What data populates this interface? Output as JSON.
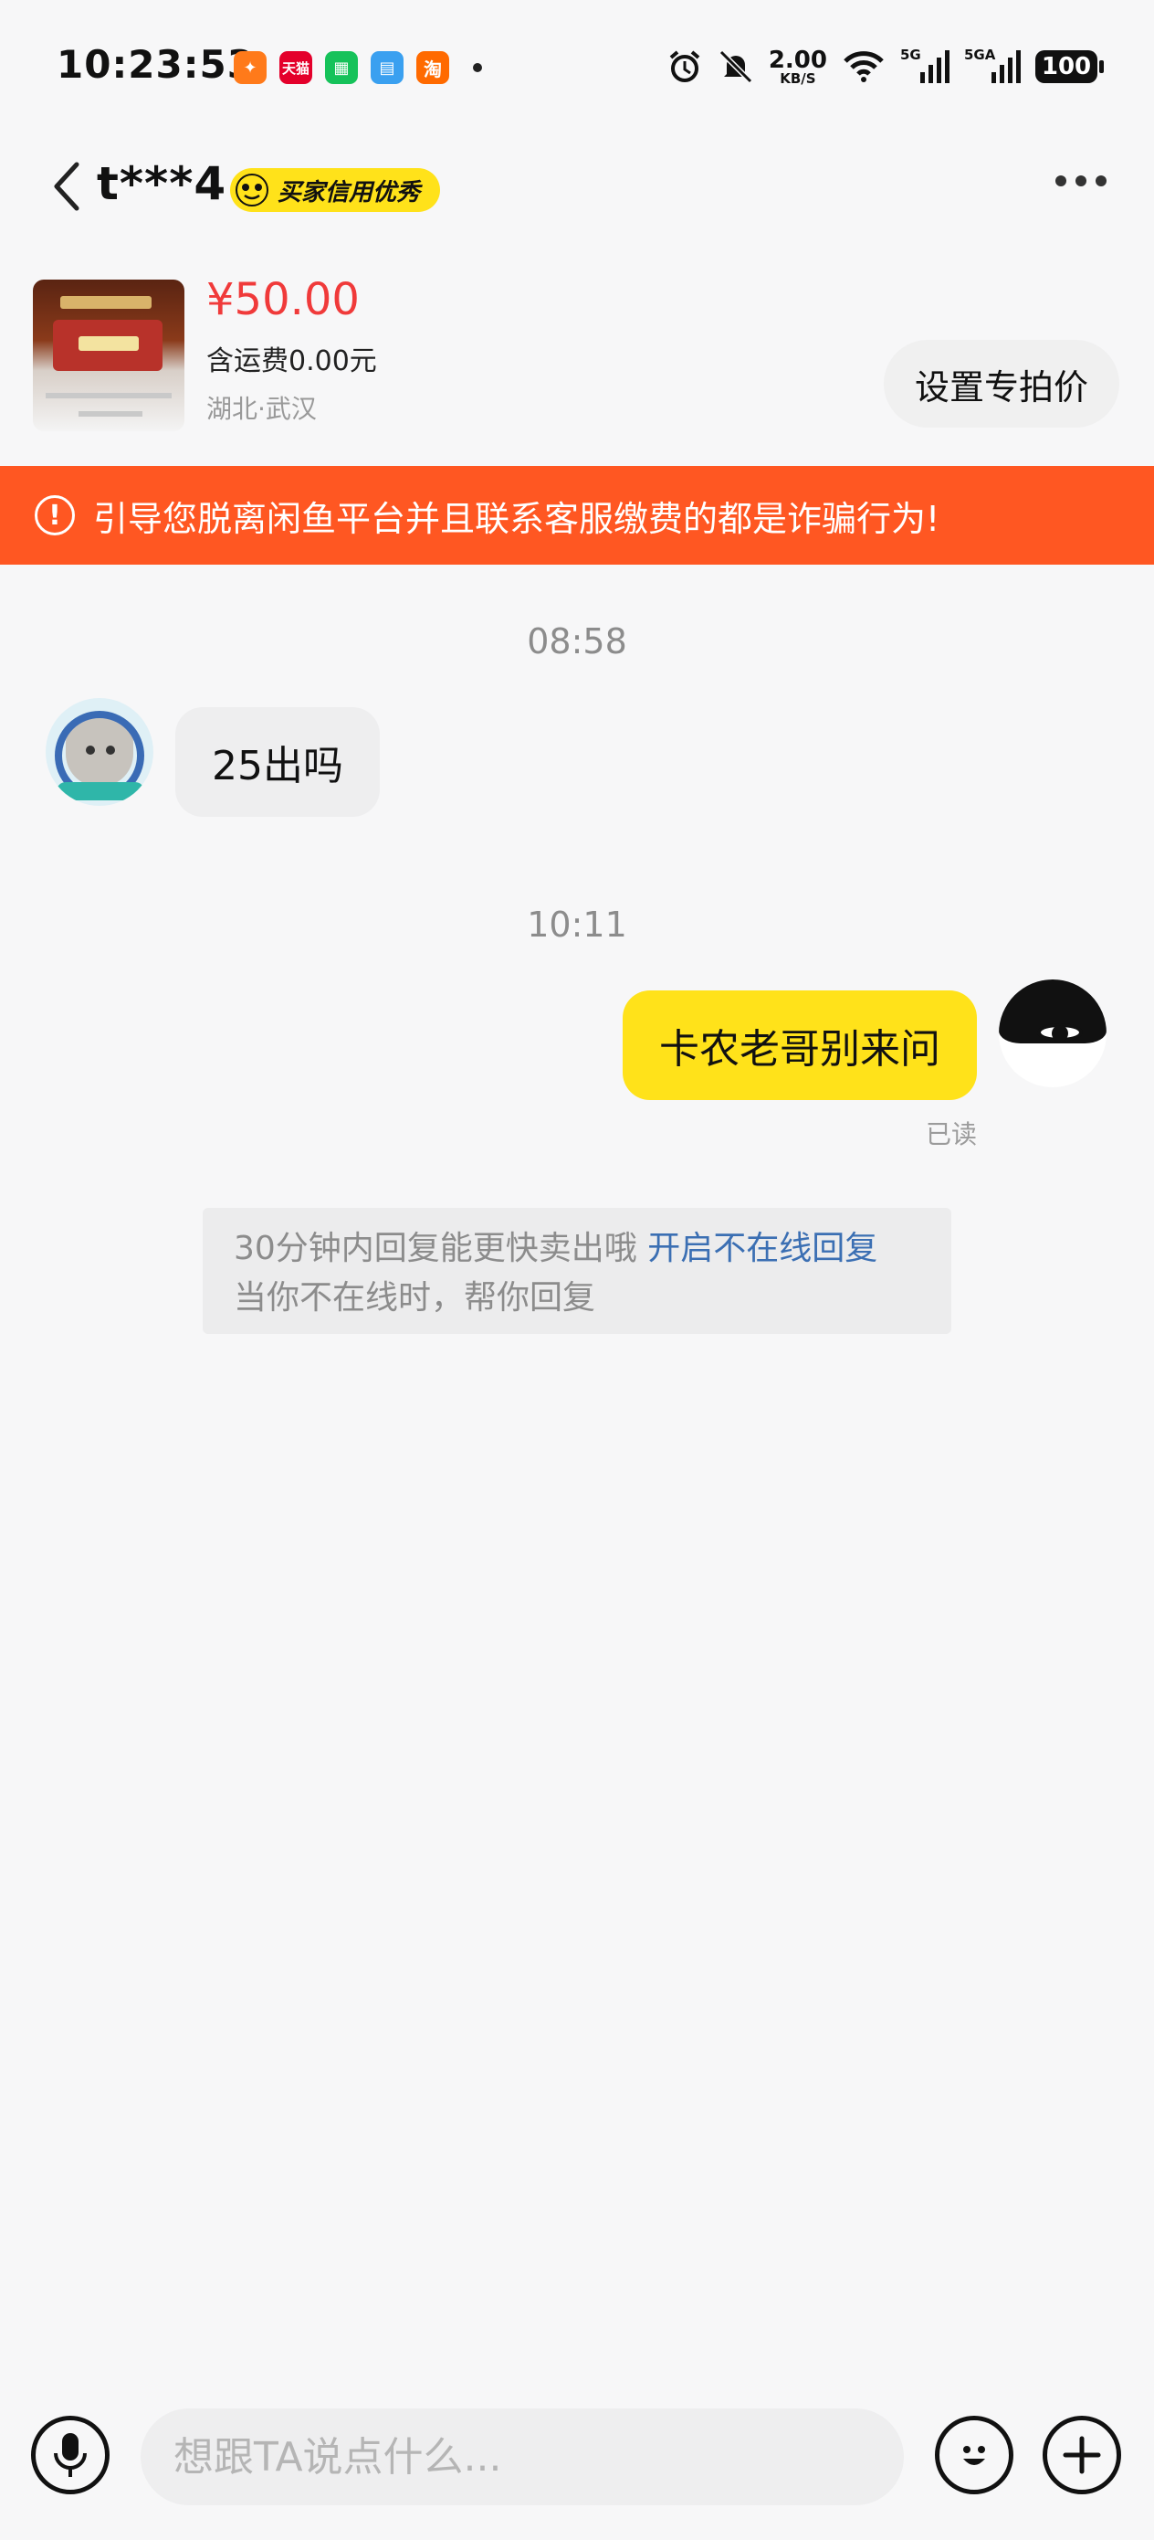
{
  "status_bar": {
    "time": "10:23:53",
    "apps": [
      "天猫",
      "淘"
    ],
    "net_speed_value": "2.00",
    "net_speed_unit": "KB/S",
    "signal_1": "5G",
    "signal_2": "5GA",
    "battery": "100"
  },
  "nav": {
    "title": "t***4",
    "credit_badge": "买家信用优秀"
  },
  "product": {
    "price": "¥50.00",
    "shipping": "含运费0.00元",
    "location": "湖北·武汉",
    "special_price_button": "设置专拍价"
  },
  "warning": {
    "text": "引导您脱离闲鱼平台并且联系客服缴费的都是诈骗行为!"
  },
  "chat": {
    "timestamp_1": "08:58",
    "message_other": "25出吗",
    "timestamp_2": "10:11",
    "message_me": "卡农老哥别来问",
    "read_status": "已读"
  },
  "tip": {
    "line1": "30分钟内回复能更快卖出哦",
    "link": "开启不在线回复",
    "line2": "当你不在线时，帮你回复"
  },
  "input": {
    "placeholder": "想跟TA说点什么..."
  },
  "colors": {
    "accent_yellow": "#ffe21a",
    "warning_orange": "#ff5722",
    "price_red": "#f03a3a",
    "link_blue": "#3b6fb3"
  }
}
